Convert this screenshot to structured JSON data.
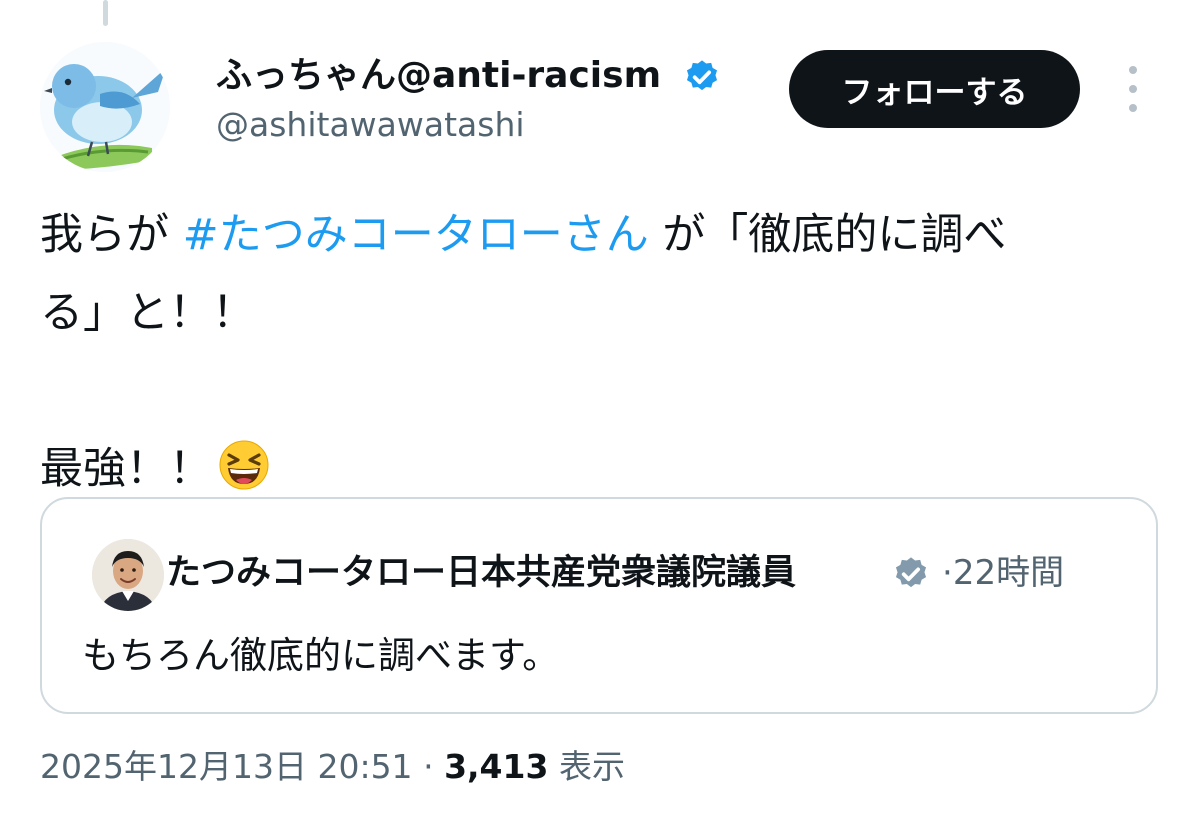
{
  "tweet": {
    "author": {
      "display_name": "ふっちゃん@anti-racism",
      "handle": "@ashitawawatashi",
      "verified_color": "#1d9bf0"
    },
    "follow_label": "フォローする",
    "text": {
      "line1_prefix": "我らが",
      "hashtag": "#たつみコータローさん",
      "line1_suffix": "が「徹底的に調べ",
      "line2": "る」と！！",
      "line3": "最強！！",
      "emoji": "grinning-squinting-face-emoji"
    },
    "quote": {
      "author_name": "たつみコータロー日本共産党衆議院議員",
      "badge_color": "#829aab",
      "separator": "·",
      "time": "22時間",
      "text": "もちろん徹底的に調べます。"
    },
    "meta": {
      "datetime": "2025年12月13日 20:51",
      "separator": "·",
      "views_count": "3,413",
      "views_label": "表示"
    }
  },
  "colors": {
    "link": "#1d9bf0",
    "secondary_text": "#536471",
    "border": "#cfd9de",
    "button_bg": "#0f1419"
  }
}
